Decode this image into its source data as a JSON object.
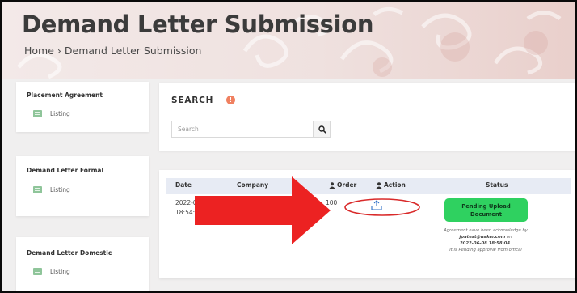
{
  "page": {
    "title": "Demand Letter Submission",
    "breadcrumb": {
      "home": "Home",
      "separator": "›",
      "current": "Demand Letter Submission"
    }
  },
  "sidebar": {
    "sections": [
      {
        "title": "Placement Agreement",
        "link": "Listing"
      },
      {
        "title": "Demand Letter Formal",
        "link": "Listing"
      },
      {
        "title": "Demand Letter Domestic",
        "link": "Listing"
      }
    ]
  },
  "search": {
    "title": "SEARCH",
    "info_icon": "info-icon",
    "placeholder": "Search",
    "button_icon": "search-icon"
  },
  "table": {
    "headers": {
      "date": "Date",
      "company": "Company",
      "order": "Order",
      "action": "Action",
      "status": "Status"
    },
    "rows": [
      {
        "date_line1": "2022-06-0",
        "date_line2": "18:54:21",
        "company": "",
        "order": "100",
        "action_icon": "upload-icon",
        "status_label_line1": "Pending Upload",
        "status_label_line2": "Document",
        "status_note_line1": "Agreement have been acknowledge by",
        "status_note_email": "jpatest@naker.com",
        "status_note_on": "on",
        "status_note_date": "2022-06-08 18:58:04.",
        "status_note_line4": "It is Pending approval from offical"
      }
    ]
  },
  "annotations": {
    "arrow_color": "#ec2222",
    "ellipse_color": "#d92a2a"
  },
  "colors": {
    "status_green": "#2fd160",
    "header_bg": "#e7ebf4",
    "info_orange": "#f08060"
  }
}
